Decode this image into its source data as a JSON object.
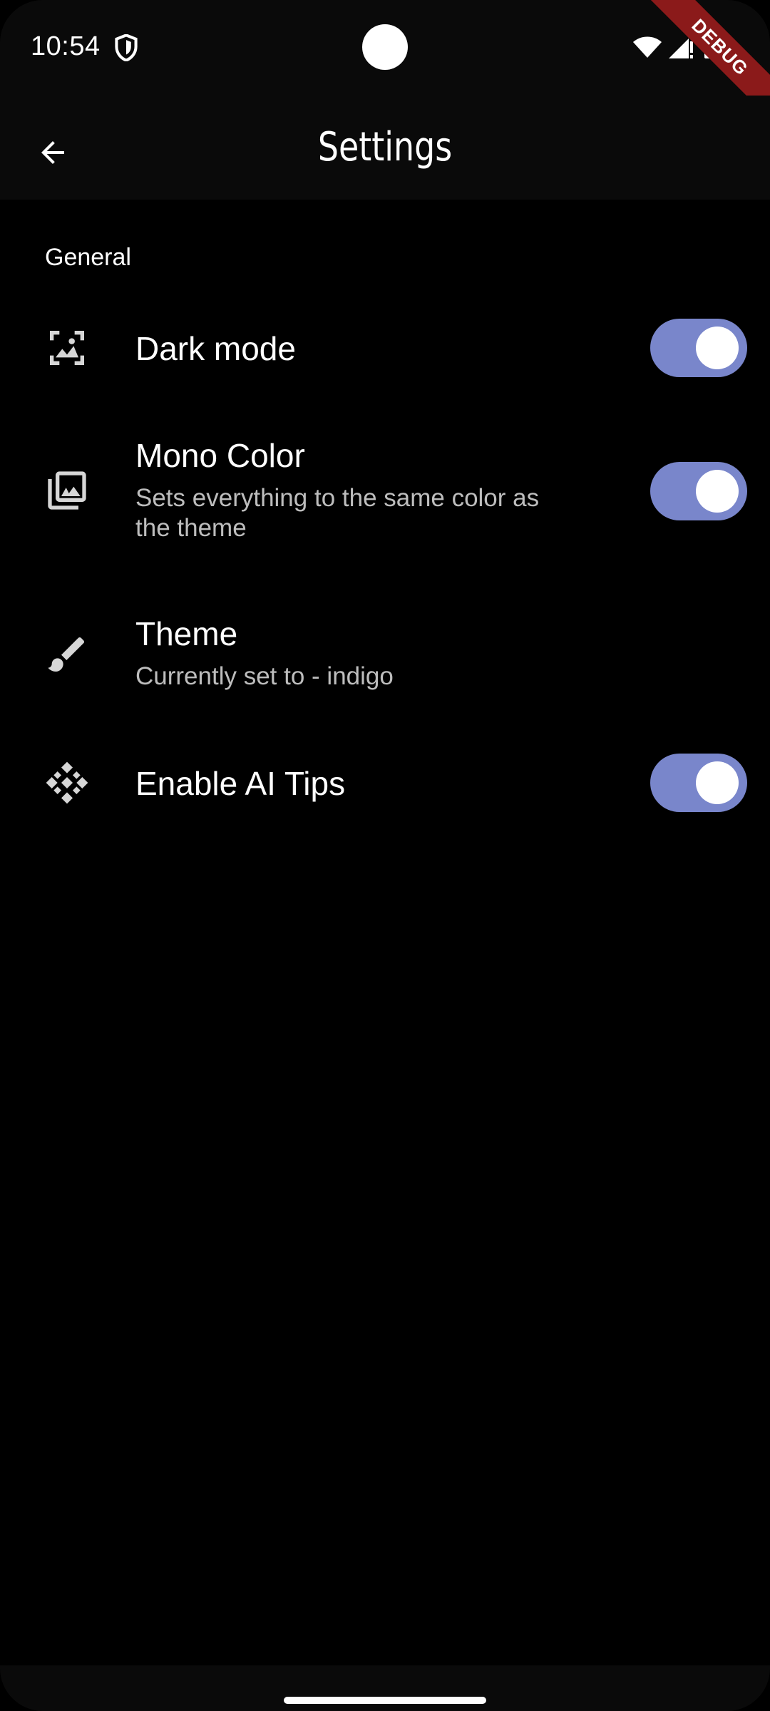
{
  "status_bar": {
    "time": "10:54",
    "debug_label": "DEBUG",
    "icons": [
      "shield-icon",
      "wifi-icon",
      "signal-icon",
      "battery-icon"
    ]
  },
  "app_bar": {
    "title": "Settings",
    "back_icon": "arrow-back-icon"
  },
  "section": {
    "title": "General"
  },
  "settings": [
    {
      "icon": "image-aspect-icon",
      "title": "Dark mode",
      "subtitle": "",
      "toggle_on": true
    },
    {
      "icon": "photo-library-icon",
      "title": "Mono Color",
      "subtitle": "Sets everything to the same color as the theme",
      "toggle_on": true
    },
    {
      "icon": "brush-icon",
      "title": "Theme",
      "subtitle": "Currently set to - indigo",
      "toggle_on": null
    },
    {
      "icon": "diamond-pattern-icon",
      "title": "Enable AI Tips",
      "subtitle": "",
      "toggle_on": true
    }
  ],
  "colors": {
    "background": "#000000",
    "bar_background": "#0a0a0a",
    "toggle_track": "#7986cb",
    "debug_banner": "#8b1a1a",
    "subtitle_text": "#bdbdbd"
  }
}
